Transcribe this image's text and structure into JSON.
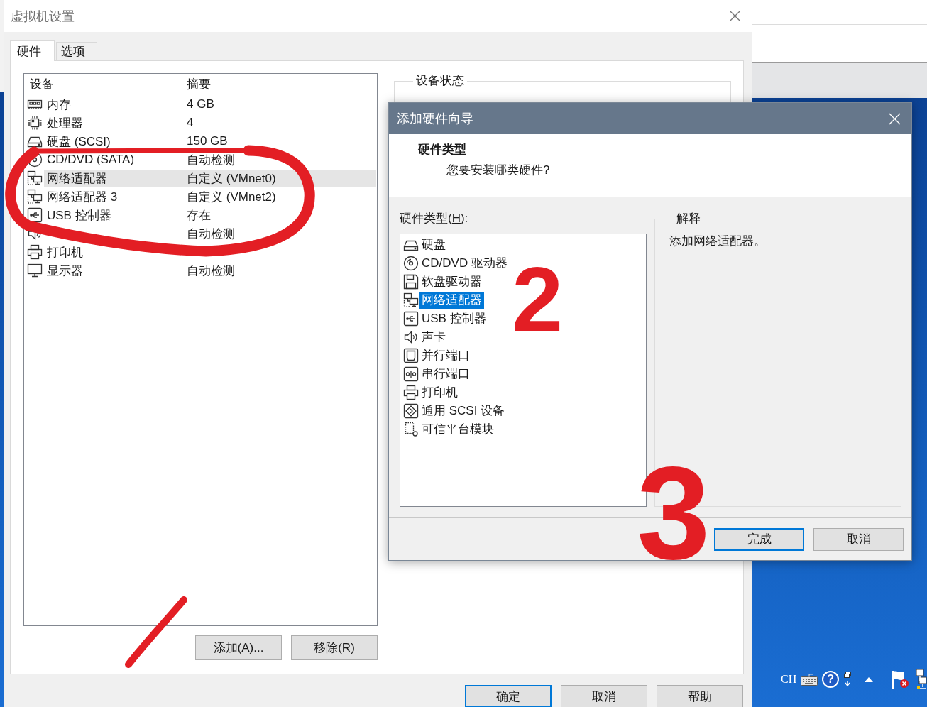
{
  "dialog": {
    "title": "虚拟机设置",
    "tabs": [
      {
        "label": "硬件",
        "selected": true
      },
      {
        "label": "选项",
        "selected": false
      }
    ],
    "devices": {
      "columns": [
        "设备",
        "摘要"
      ],
      "rows": [
        {
          "kind": "memory",
          "name": "内存",
          "summary": "4 GB",
          "selected": false
        },
        {
          "kind": "cpu",
          "name": "处理器",
          "summary": "4",
          "selected": false
        },
        {
          "kind": "disk",
          "name": "硬盘 (SCSI)",
          "summary": "150 GB",
          "selected": false
        },
        {
          "kind": "cdrom",
          "name": "CD/DVD (SATA)",
          "summary": "自动检测",
          "selected": false
        },
        {
          "kind": "network",
          "name": "网络适配器",
          "summary": "自定义 (VMnet0)",
          "selected": true
        },
        {
          "kind": "network",
          "name": "网络适配器 3",
          "summary": "自定义 (VMnet2)",
          "selected": false
        },
        {
          "kind": "usb",
          "name": "USB 控制器",
          "summary": "存在",
          "selected": false
        },
        {
          "kind": "sound",
          "summary": "自动检测",
          "selected": false
        },
        {
          "kind": "printer",
          "name": "打印机",
          "selected": false
        },
        {
          "kind": "display",
          "name": "显示器",
          "summary": "自动检测",
          "selected": false
        }
      ]
    },
    "device_buttons": [
      "添加(A)...",
      "移除(R)"
    ],
    "status_group": {
      "title": "设备状态"
    },
    "buttons": [
      {
        "label": "确定",
        "default": true
      },
      {
        "label": "取消",
        "default": false
      },
      {
        "label": "帮助",
        "default": false
      }
    ]
  },
  "wizard": {
    "title": "添加硬件向导",
    "heading": "硬件类型",
    "subheading": "您要安装哪类硬件?",
    "list_label": {
      "prefix": "硬件类型(",
      "access_key": "H",
      "suffix": "):"
    },
    "items": [
      {
        "kind": "disk",
        "label": "硬盘",
        "selected": false
      },
      {
        "kind": "cdrom",
        "label": "CD/DVD 驱动器",
        "selected": false
      },
      {
        "kind": "floppy",
        "label": "软盘驱动器",
        "selected": false
      },
      {
        "kind": "network",
        "label": "网络适配器",
        "selected": true
      },
      {
        "kind": "usb",
        "label": "USB 控制器",
        "selected": false
      },
      {
        "kind": "sound",
        "label": "声卡",
        "selected": false
      },
      {
        "kind": "parallel",
        "label": "并行端口",
        "selected": false
      },
      {
        "kind": "serial",
        "label": "串行端口",
        "selected": false
      },
      {
        "kind": "printer",
        "label": "打印机",
        "selected": false
      },
      {
        "kind": "scsi",
        "label": "通用 SCSI 设备",
        "selected": false
      },
      {
        "kind": "tpm",
        "label": "可信平台模块",
        "selected": false
      }
    ],
    "explanation": {
      "title": "解释",
      "text": "添加网络适配器。"
    },
    "buttons": [
      {
        "label": "完成",
        "default": true
      },
      {
        "label": "取消",
        "default": false
      }
    ]
  },
  "annotations": [
    {
      "kind": "ellipse"
    },
    {
      "kind": "numeral",
      "text": "2"
    },
    {
      "kind": "numeral",
      "text": "3"
    },
    {
      "kind": "stroke"
    }
  ],
  "tray": {
    "language": "CH",
    "help": "?"
  }
}
